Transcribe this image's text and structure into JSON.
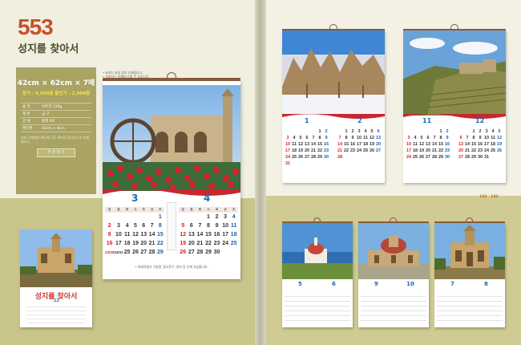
{
  "product": {
    "number": "553",
    "title": "성지를 찾아서"
  },
  "spec": {
    "size": "42cm × 62cm × 7매",
    "price": "정가 : 5,500원",
    "sale": "할인가 : 2,900원",
    "rows": [
      {
        "k": "용  지",
        "v": "아트지 120g"
      },
      {
        "k": "제  본",
        "v": "금 구"
      },
      {
        "k": "인  쇄",
        "v": "옵셋 4도"
      },
      {
        "k": "메인판",
        "v": "42cm × 8cm"
      }
    ],
    "note": "기본 단체명은 하단에, 1도 흑자로 광고문구가 인쇄됩니다.",
    "button": "주 문 하 기"
  },
  "thumbnail": {
    "title": "성지를 찾아서",
    "month": "12"
  },
  "notes": {
    "line1": "• 표지는 요일 없이 인쇄됩니다.",
    "line2": "• 이미지는 실제와 다를 수 있습니다."
  },
  "main_calendar": {
    "month_left": "3",
    "month_right": "4",
    "weekday_headers": [
      "일",
      "월",
      "화",
      "수",
      "목",
      "금",
      "토"
    ],
    "left_days": [
      "",
      "",
      "",
      "",
      "",
      "",
      "1",
      "2",
      "3",
      "4",
      "5",
      "6",
      "7",
      "8",
      "9",
      "10",
      "11",
      "12",
      "13",
      "14",
      "15",
      "16",
      "17",
      "18",
      "19",
      "20",
      "21",
      "22",
      "23/30",
      "24/31",
      "25",
      "26",
      "27",
      "28",
      "29"
    ],
    "right_days": [
      "",
      "",
      "",
      "1",
      "2",
      "3",
      "4",
      "5",
      "6",
      "7",
      "8",
      "9",
      "10",
      "11",
      "12",
      "13",
      "14",
      "15",
      "16",
      "17",
      "18",
      "19",
      "20",
      "21",
      "22",
      "23",
      "24",
      "25",
      "26",
      "27",
      "28",
      "29",
      "30",
      "",
      ""
    ],
    "footer": "• 미래지향사 기업명, 광고문구, 일지 등 인쇄 가능합니다."
  },
  "mini_calendars": [
    {
      "months": [
        "1",
        "2"
      ],
      "left_days": [
        "",
        "",
        "",
        "",
        "",
        "1",
        "2",
        "3",
        "4",
        "5",
        "6",
        "7",
        "8",
        "9",
        "10",
        "11",
        "12",
        "13",
        "14",
        "15",
        "16",
        "17",
        "18",
        "19",
        "20",
        "21",
        "22",
        "23",
        "24",
        "25",
        "26",
        "27",
        "28",
        "29",
        "30",
        "31"
      ],
      "right_days": [
        "",
        "1",
        "2",
        "3",
        "4",
        "5",
        "6",
        "7",
        "8",
        "9",
        "10",
        "11",
        "12",
        "13",
        "14",
        "15",
        "16",
        "17",
        "18",
        "19",
        "20",
        "21",
        "22",
        "23",
        "24",
        "25",
        "26",
        "27",
        "28"
      ]
    },
    {
      "months": [
        "11",
        "12"
      ],
      "left_days": [
        "",
        "",
        "",
        "",
        "",
        "1",
        "2",
        "3",
        "4",
        "5",
        "6",
        "7",
        "8",
        "9",
        "10",
        "11",
        "12",
        "13",
        "14",
        "15",
        "16",
        "17",
        "18",
        "19",
        "20",
        "21",
        "22",
        "23",
        "24",
        "25",
        "26",
        "27",
        "28",
        "29",
        "30"
      ],
      "right_days": [
        "",
        "",
        "1",
        "2",
        "3",
        "4",
        "5",
        "6",
        "7",
        "8",
        "9",
        "10",
        "11",
        "12",
        "13",
        "14",
        "15",
        "16",
        "17",
        "18",
        "19",
        "20",
        "21",
        "22",
        "23",
        "24",
        "25",
        "26",
        "27",
        "28",
        "29",
        "30",
        "31"
      ]
    }
  ],
  "small_calendars": [
    {
      "months": [
        "5",
        "6"
      ]
    },
    {
      "months": [
        "9",
        "10"
      ]
    },
    {
      "months": [
        "7",
        "8"
      ]
    }
  ],
  "page_number": "142 · 143"
}
